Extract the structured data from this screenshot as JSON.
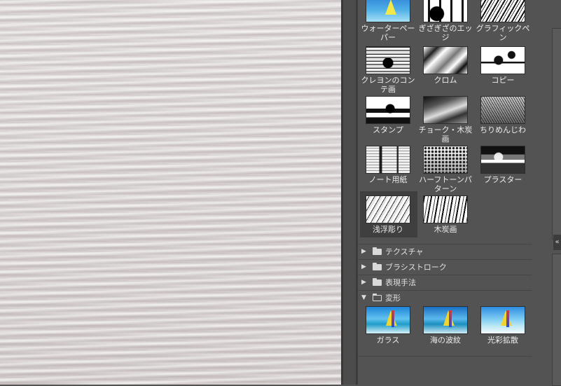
{
  "filters": {
    "artistic_row": [
      {
        "label": "ウォーターペーパー",
        "icon": "watercolor-paper-thumb"
      },
      {
        "label": "ぎざぎざのエッジ",
        "icon": "torn-edges-thumb"
      },
      {
        "label": "グラフィックペン",
        "icon": "graphic-pen-thumb"
      }
    ],
    "sketch": [
      {
        "label": "クレヨンのコンテ画",
        "icon": "conte-crayon-thumb"
      },
      {
        "label": "クロム",
        "icon": "chrome-thumb"
      },
      {
        "label": "コピー",
        "icon": "photocopy-thumb"
      },
      {
        "label": "スタンプ",
        "icon": "stamp-thumb"
      },
      {
        "label": "チョーク・木炭画",
        "icon": "chalk-charcoal-thumb"
      },
      {
        "label": "ちりめんじわ",
        "icon": "reticulation-thumb"
      },
      {
        "label": "ノート用紙",
        "icon": "note-paper-thumb"
      },
      {
        "label": "ハーフトーンパターン",
        "icon": "halftone-pattern-thumb"
      },
      {
        "label": "プラスター",
        "icon": "plaster-thumb"
      },
      {
        "label": "浅浮彫り",
        "icon": "bas-relief-thumb",
        "selected": true
      },
      {
        "label": "木炭画",
        "icon": "charcoal-thumb"
      }
    ]
  },
  "categories": [
    {
      "label": "テクスチャ",
      "expanded": false
    },
    {
      "label": "ブラシストローク",
      "expanded": false
    },
    {
      "label": "表現手法",
      "expanded": false
    },
    {
      "label": "変形",
      "expanded": true
    }
  ],
  "distort": [
    {
      "label": "ガラス",
      "icon": "glass-thumb"
    },
    {
      "label": "海の波紋",
      "icon": "ocean-ripple-thumb"
    },
    {
      "label": "光彩拡散",
      "icon": "diffuse-glow-thumb"
    }
  ],
  "glyphs": {
    "collapsed": "▶",
    "expanded": "▼",
    "collapse_panel": "«"
  }
}
